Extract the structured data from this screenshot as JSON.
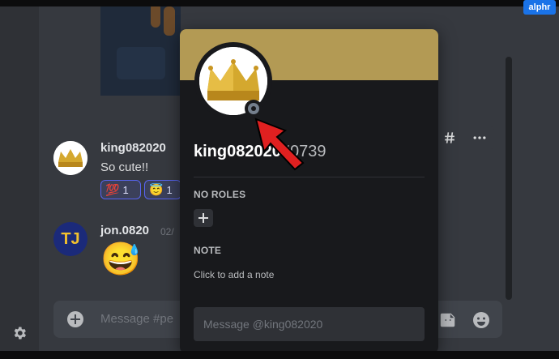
{
  "messages": [
    {
      "username": "king082020",
      "text": "So cute!!",
      "reactions": [
        {
          "emoji": "💯",
          "count": "1"
        },
        {
          "emoji": "😇",
          "count": "1"
        }
      ]
    },
    {
      "username": "jon.0820",
      "timestamp": "02/",
      "avatar_text": "TJ",
      "emoji": "😅"
    }
  ],
  "composer": {
    "placeholder": "Message #pe"
  },
  "profile_popout": {
    "username": "king082020",
    "discriminator": "#0739",
    "roles_heading": "NO ROLES",
    "note_heading": "NOTE",
    "note_placeholder": "Click to add a note",
    "message_placeholder": "Message @king082020",
    "banner_color": "#b39a54",
    "status": "offline"
  },
  "watermark": "alphr",
  "icons": {
    "settings": "gear-icon",
    "add": "plus-icon",
    "threads": "threads-icon",
    "more": "more-icon",
    "gift": "gift-icon",
    "gif": "gif-icon",
    "sticker": "sticker-icon",
    "emoji": "emoji-icon",
    "arrow": "red-arrow-icon"
  }
}
